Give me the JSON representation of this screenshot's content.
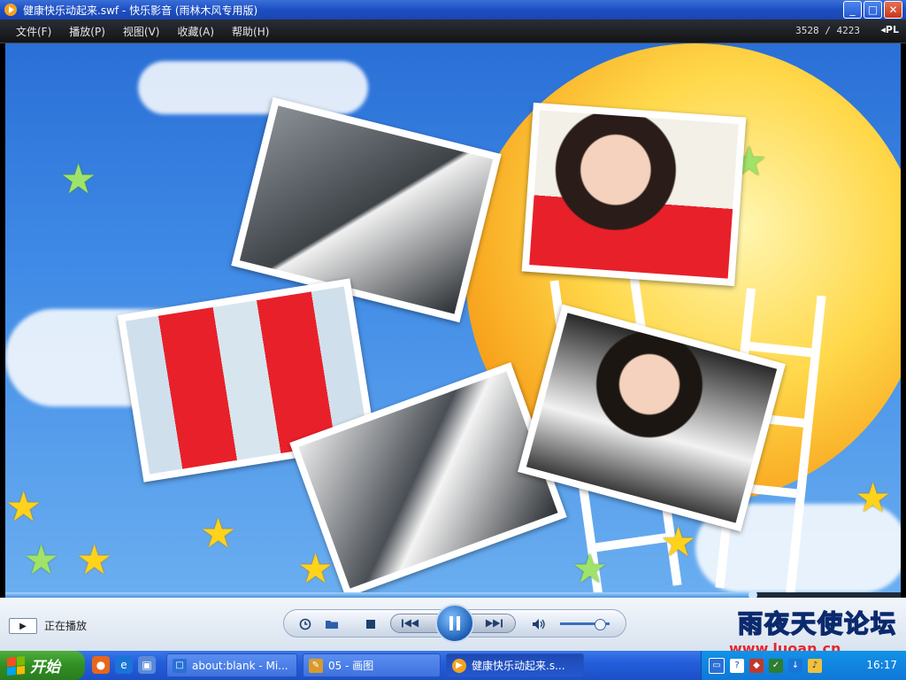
{
  "window": {
    "title": "健康快乐动起来.swf - 快乐影音 (雨林木风专用版)",
    "buttons": [
      "_",
      "□",
      "✕"
    ]
  },
  "menu": {
    "items": [
      "文件(F)",
      "播放(P)",
      "视图(V)",
      "收藏(A)",
      "帮助(H)"
    ],
    "counter": "3528 / 4223",
    "playlist_label": "PL"
  },
  "player": {
    "progress_fraction": 0.835,
    "volume_fraction": 0.8,
    "status_text": "正在播放",
    "status_icon": "▶"
  },
  "controls": {
    "icons": [
      "clock-icon",
      "folder-icon",
      "stop-icon",
      "prev-icon",
      "pause-icon",
      "next-icon",
      "volume-icon"
    ]
  },
  "watermark": {
    "text": "雨夜天使论坛",
    "url": "www.luoan.cn"
  },
  "taskbar": {
    "start_label": "开始",
    "tasks": [
      {
        "label": "about:blank - Mi..."
      },
      {
        "label": "05 - 画图"
      },
      {
        "label": "健康快乐动起来.s..."
      }
    ],
    "clock": "16:17"
  },
  "colors": {
    "title_blue": "#245edb",
    "sky": "#3f8ae6",
    "sun": "#ffd84a",
    "star": "#ffd21c",
    "dress_red": "#e8202a"
  }
}
